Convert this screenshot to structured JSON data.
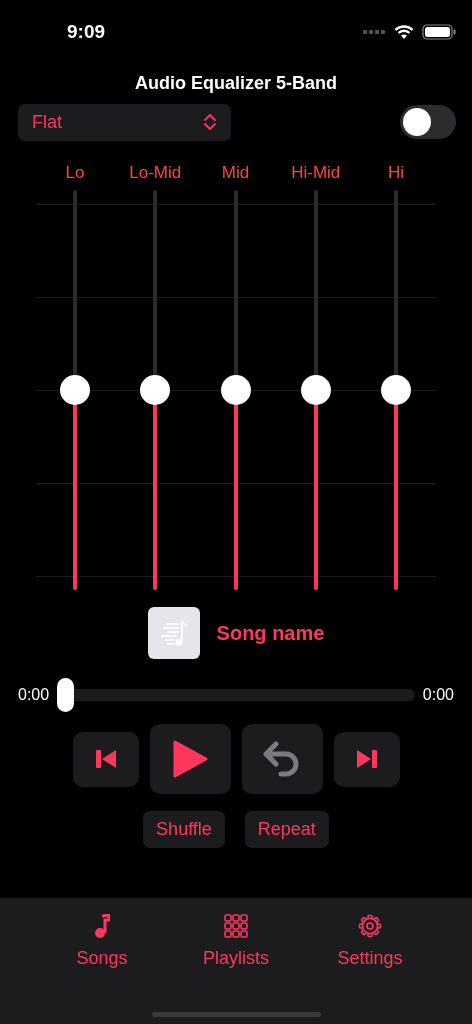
{
  "status_bar": {
    "time": "9:09"
  },
  "title": "Audio Equalizer 5-Band",
  "preset": {
    "value": "Flat"
  },
  "toggle": {
    "on": false
  },
  "bands": [
    {
      "label": "Lo",
      "level": 0.5
    },
    {
      "label": "Lo-Mid",
      "level": 0.5
    },
    {
      "label": "Mid",
      "level": 0.5
    },
    {
      "label": "Hi-Mid",
      "level": 0.5
    },
    {
      "label": "Hi",
      "level": 0.5
    }
  ],
  "song": {
    "name": "Song name"
  },
  "progress": {
    "elapsed": "0:00",
    "remaining": "0:00",
    "level": 0
  },
  "controls": [
    {
      "kind": "previous",
      "disabled": false
    },
    {
      "kind": "play",
      "disabled": false
    },
    {
      "kind": "undo",
      "disabled": true
    },
    {
      "kind": "next",
      "disabled": false
    }
  ],
  "options": [
    "Shuffle",
    "Repeat"
  ],
  "tabs": [
    {
      "kind": "songs",
      "label": "Songs"
    },
    {
      "kind": "playlists",
      "label": "Playlists"
    },
    {
      "kind": "settings",
      "label": "Settings"
    }
  ]
}
